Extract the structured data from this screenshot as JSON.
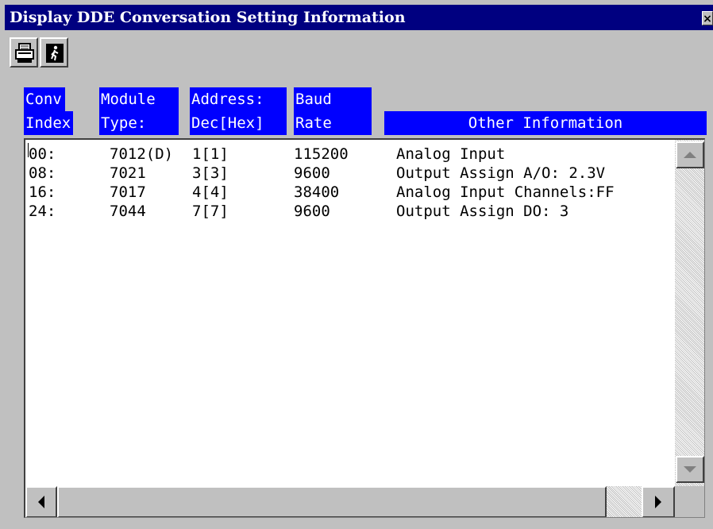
{
  "window": {
    "title": "Display DDE Conversation Setting Information",
    "close_label": "×"
  },
  "toolbar": {
    "print_icon": "printer-icon",
    "exit_icon": "exit-door-icon"
  },
  "columns": [
    {
      "line1": "Conv",
      "line2": "Index"
    },
    {
      "line1": "Module",
      "line2": "Type:"
    },
    {
      "line1": "Address:",
      "line2": "Dec[Hex]"
    },
    {
      "line1": "Baud",
      "line2": "Rate"
    },
    {
      "line1": "",
      "line2": "Other Information"
    }
  ],
  "rows": [
    {
      "index": "00:",
      "module": "7012(D)",
      "address": "1[1]",
      "baud": "115200",
      "info": "Analog Input"
    },
    {
      "index": "08:",
      "module": "7021",
      "address": "3[3]",
      "baud": "9600",
      "info": "Output Assign A/O: 2.3V"
    },
    {
      "index": "16:",
      "module": "7017",
      "address": "4[4]",
      "baud": "38400",
      "info": "Analog Input Channels:FF"
    },
    {
      "index": "24:",
      "module": "7044",
      "address": "7[7]",
      "baud": "9600",
      "info": "Output Assign DO:  3"
    }
  ],
  "colors": {
    "title_bar": "#000080",
    "header_bg": "#0000ff",
    "window_bg": "#c0c0c0"
  }
}
